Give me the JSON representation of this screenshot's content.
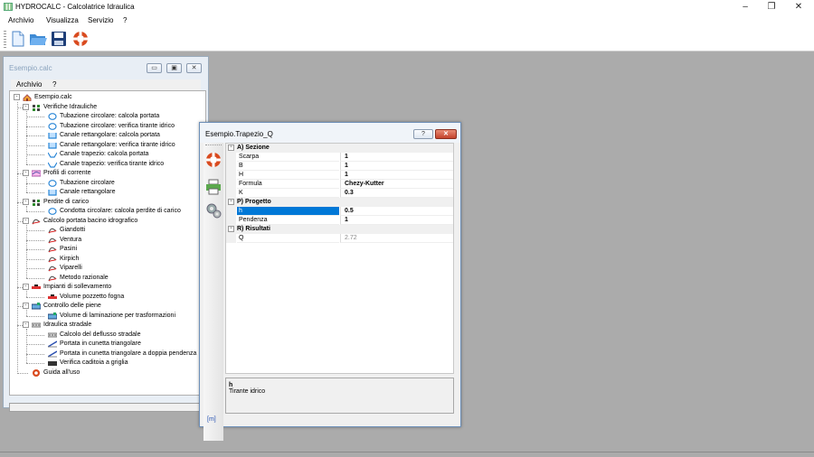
{
  "app": {
    "title": "HYDROCALC - Calcolatrice Idraulica"
  },
  "window_controls": {
    "minimize": "–",
    "restore": "❐",
    "close": "✕"
  },
  "menu": [
    "Archivio",
    "Visualizza",
    "Servizio",
    "?"
  ],
  "toolbar": [
    {
      "name": "new-file-button",
      "icon": "new-document-icon"
    },
    {
      "name": "open-file-button",
      "icon": "open-folder-icon"
    },
    {
      "name": "save-file-button",
      "icon": "save-floppy-icon"
    },
    {
      "name": "help-button",
      "icon": "lifebuoy-icon"
    }
  ],
  "tree_window": {
    "title": "Esempio.calc",
    "menu": [
      "Archivio",
      "?"
    ],
    "items": [
      {
        "label": "Esempio.calc",
        "level": 0,
        "expand": "-",
        "icon": "home"
      },
      {
        "label": "Verifiche Idrauliche",
        "level": 1,
        "expand": "-",
        "icon": "net"
      },
      {
        "label": "Tubazione circolare: calcola portata",
        "level": 2,
        "icon": "circle"
      },
      {
        "label": "Tubazione circolare: verifica tirante idrico",
        "level": 2,
        "icon": "circle"
      },
      {
        "label": "Canale rettangolare: calcola portata",
        "level": 2,
        "icon": "rect"
      },
      {
        "label": "Canale rettangolare: verifica tirante idrico",
        "level": 2,
        "icon": "rect"
      },
      {
        "label": "Canale trapezio: calcola portata",
        "level": 2,
        "icon": "trap"
      },
      {
        "label": "Canale trapezio: verifica tirante idrico",
        "level": 2,
        "icon": "trap"
      },
      {
        "label": "Profili di corrente",
        "level": 1,
        "expand": "-",
        "icon": "profile"
      },
      {
        "label": "Tubazione circolare",
        "level": 2,
        "icon": "circle"
      },
      {
        "label": "Canale rettangolare",
        "level": 2,
        "icon": "rect"
      },
      {
        "label": "Perdite di carico",
        "level": 1,
        "expand": "-",
        "icon": "net"
      },
      {
        "label": "Condotta circolare: calcola perdite di carico",
        "level": 2,
        "icon": "circle"
      },
      {
        "label": "Calcolo portata bacino idrografico",
        "level": 1,
        "expand": "-",
        "icon": "curve"
      },
      {
        "label": "Giandotti",
        "level": 2,
        "icon": "curve"
      },
      {
        "label": "Ventura",
        "level": 2,
        "icon": "curve"
      },
      {
        "label": "Pasini",
        "level": 2,
        "icon": "curve"
      },
      {
        "label": "Kirpich",
        "level": 2,
        "icon": "curve"
      },
      {
        "label": "Viparelli",
        "level": 2,
        "icon": "curve"
      },
      {
        "label": "Metodo razionale",
        "level": 2,
        "icon": "curve"
      },
      {
        "label": "Impianti di sollevamento",
        "level": 1,
        "expand": "-",
        "icon": "pump"
      },
      {
        "label": "Volume pozzetto fogna",
        "level": 2,
        "icon": "pump"
      },
      {
        "label": "Controllo delle piene",
        "level": 1,
        "expand": "-",
        "icon": "flood"
      },
      {
        "label": "Volume di laminazione per trasformazioni",
        "level": 2,
        "icon": "flood"
      },
      {
        "label": "Idraulica stradale",
        "level": 1,
        "expand": "-",
        "icon": "road"
      },
      {
        "label": "Calcolo del deflusso stradale",
        "level": 2,
        "icon": "road"
      },
      {
        "label": "Portata in cunetta triangolare",
        "level": 2,
        "icon": "slope"
      },
      {
        "label": "Portata in cunetta triangolare a doppia pendenza",
        "level": 2,
        "icon": "slope"
      },
      {
        "label": "Verifica caditoia a griglia",
        "level": 2,
        "icon": "grate"
      },
      {
        "label": "Guida all'uso",
        "level": 1,
        "icon": "buoy"
      }
    ]
  },
  "property_window": {
    "title": "Esempio.Trapezio_Q",
    "help_btn": "?",
    "close_btn": "✕",
    "sections": [
      {
        "title": "A) Sezione",
        "rows": [
          {
            "label": "Scarpa",
            "value": "1"
          },
          {
            "label": "B",
            "value": "1"
          },
          {
            "label": "H",
            "value": "1"
          },
          {
            "label": "Formula",
            "value": "Chezy-Kutter"
          },
          {
            "label": "K",
            "value": "0.3"
          }
        ]
      },
      {
        "title": "P) Progetto",
        "rows": [
          {
            "label": "h",
            "value": "0.5",
            "selected": true
          },
          {
            "label": "Pendenza",
            "value": "1"
          }
        ]
      },
      {
        "title": "R) Risultati",
        "rows": [
          {
            "label": "Q",
            "value": "2.72",
            "readonly": true
          }
        ]
      }
    ],
    "description": {
      "name": "h",
      "text": "Tirante idrico"
    },
    "unit": "[m]"
  },
  "colors": {
    "mdi_bg": "#ababab",
    "selection": "#0078d7",
    "active_border": "#6d8fb8",
    "close_red": "#c4422b"
  }
}
